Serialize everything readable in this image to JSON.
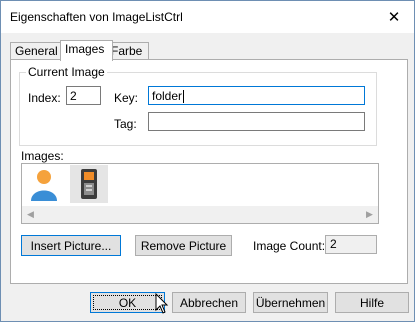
{
  "window": {
    "title": "Eigenschaften von ImageListCtrl",
    "close_glyph": "✕"
  },
  "tabs": [
    {
      "label": "General",
      "active": false
    },
    {
      "label": "Images",
      "active": true
    },
    {
      "label": "Farbe",
      "active": false
    }
  ],
  "current_image": {
    "group_label": "Current Image",
    "index_label": "Index:",
    "index_value": "2",
    "key_label": "Key:",
    "key_value": "folder",
    "tag_label": "Tag:",
    "tag_value": ""
  },
  "images": {
    "label": "Images:",
    "items": [
      {
        "icon": "person-icon",
        "selected": false
      },
      {
        "icon": "phone-icon",
        "selected": true
      }
    ],
    "scroll_left": "◀",
    "scroll_right": "▶"
  },
  "actions": {
    "insert_label": "Insert Picture...",
    "remove_label": "Remove Picture",
    "count_label": "Image Count:",
    "count_value": "2"
  },
  "footer": {
    "ok": "OK",
    "cancel": "Abbrechen",
    "apply": "Übernehmen",
    "help": "Hilfe"
  },
  "colors": {
    "accent": "#0078d7",
    "person_head": "#f5a23c",
    "person_body": "#3a8ed6"
  }
}
